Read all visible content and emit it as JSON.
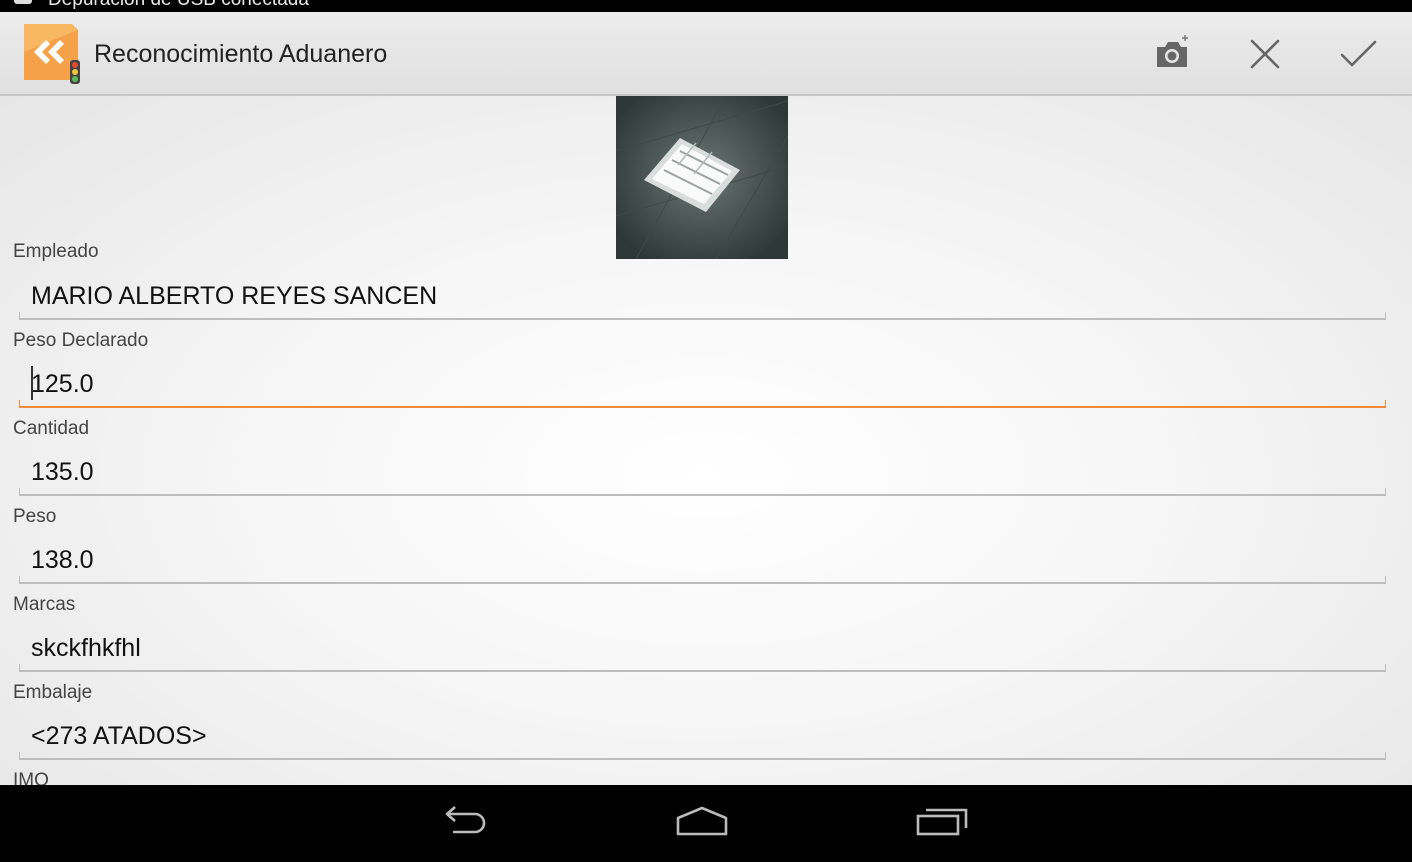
{
  "status_bar": {
    "text": "Depuración de USB conectada",
    "icon": "usb-debug-icon"
  },
  "action_bar": {
    "title": "Reconocimiento Aduanero",
    "app_icon": "app-logo-icon",
    "actions": [
      {
        "name": "camera",
        "icon": "add-photo-icon"
      },
      {
        "name": "cancel",
        "icon": "close-icon"
      },
      {
        "name": "confirm",
        "icon": "check-icon"
      }
    ],
    "accent": "#f08a3c"
  },
  "photo": {
    "icon": "photo-thumbnail"
  },
  "fields": {
    "empleado": {
      "label": "Empleado",
      "value": "MARIO ALBERTO REYES SANCEN"
    },
    "peso_declarado": {
      "label": "Peso Declarado",
      "value": "125.0"
    },
    "cantidad": {
      "label": "Cantidad",
      "value": "135.0"
    },
    "peso": {
      "label": "Peso",
      "value": "138.0"
    },
    "marcas": {
      "label": "Marcas",
      "value": "skckfhkfhl"
    },
    "embalaje": {
      "label": "Embalaje",
      "value": "<273 ATADOS>"
    },
    "imo": {
      "label": "IMO"
    }
  },
  "nav_bar": {
    "buttons": [
      "back-icon",
      "home-icon",
      "recent-apps-icon"
    ]
  }
}
